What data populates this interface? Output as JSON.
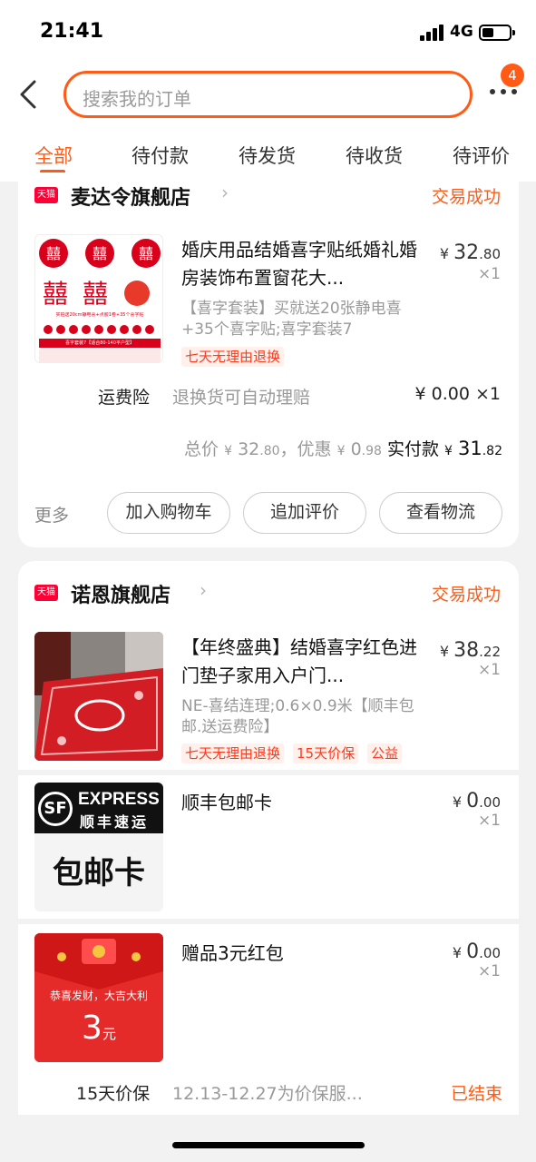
{
  "status_bar": {
    "time": "21:41",
    "network": "4G"
  },
  "header": {
    "search_placeholder": "搜索我的订单",
    "notification_count": "4"
  },
  "tabs": [
    "全部",
    "待付款",
    "待发货",
    "待收货",
    "待评价"
  ],
  "orders": [
    {
      "platform_badge": "天猫",
      "shop_name": "麦达令旗舰店",
      "status": "交易成功",
      "item": {
        "title": "婚庆用品结婚喜字贴纸婚礼婚房装饰布置窗花大...",
        "spec": "【喜字套装】买就送20张静电喜+35个喜字贴;喜字套装7",
        "tags": [
          "七天无理由退换"
        ],
        "price_int": "32",
        "price_dec": ".80",
        "qty": "×1",
        "thumb_captions": [
          "实拍送20cm静电喜+点胶1卷+35个喜字贴",
          "喜字套装7【适合80-140平户型】"
        ]
      },
      "insurance": {
        "label": "运费险",
        "desc": "退换货可自动理赔",
        "price": "¥ 0.00 ×1"
      },
      "totals": {
        "total_label": "总价",
        "total_int": "32",
        "total_dec": ".80",
        "discount_label": "，优惠",
        "discount_int": "0",
        "discount_dec": ".98",
        "paid_label": "实付款",
        "paid_int": "31",
        "paid_dec": ".82"
      },
      "actions": {
        "more": "更多",
        "buttons": [
          "加入购物车",
          "追加评价",
          "查看物流"
        ]
      }
    },
    {
      "platform_badge": "天猫",
      "shop_name": "诺恩旗舰店",
      "status": "交易成功",
      "item": {
        "title": "【年终盛典】结婚喜字红色进门垫子家用入户门...",
        "spec": "NE-喜结连理;0.6×0.9米【顺丰包邮.送运费险】",
        "tags": [
          "七天无理由退换",
          "15天价保",
          "公益"
        ],
        "price_int": "38",
        "price_dec": ".22",
        "qty": "×1"
      },
      "gifts": [
        {
          "title": "顺丰包邮卡",
          "price_int": "0",
          "price_dec": ".00",
          "qty": "×1",
          "thumb": {
            "logo": "EXPRESS",
            "logo_sub": "顺丰速运",
            "card_text": "包邮卡"
          }
        },
        {
          "title": "赠品3元红包",
          "price_int": "0",
          "price_dec": ".00",
          "qty": "×1",
          "thumb": {
            "caption": "恭喜发财，大吉大利",
            "amount": "3",
            "unit": "元"
          }
        }
      ],
      "price_protection": {
        "label": "15天价保",
        "desc": "12.13-12.27为价保服...",
        "status": "已结束"
      }
    }
  ],
  "colors": {
    "accent": "#ff5b16",
    "tmall": "#ff0036",
    "red": "#d9001b"
  }
}
